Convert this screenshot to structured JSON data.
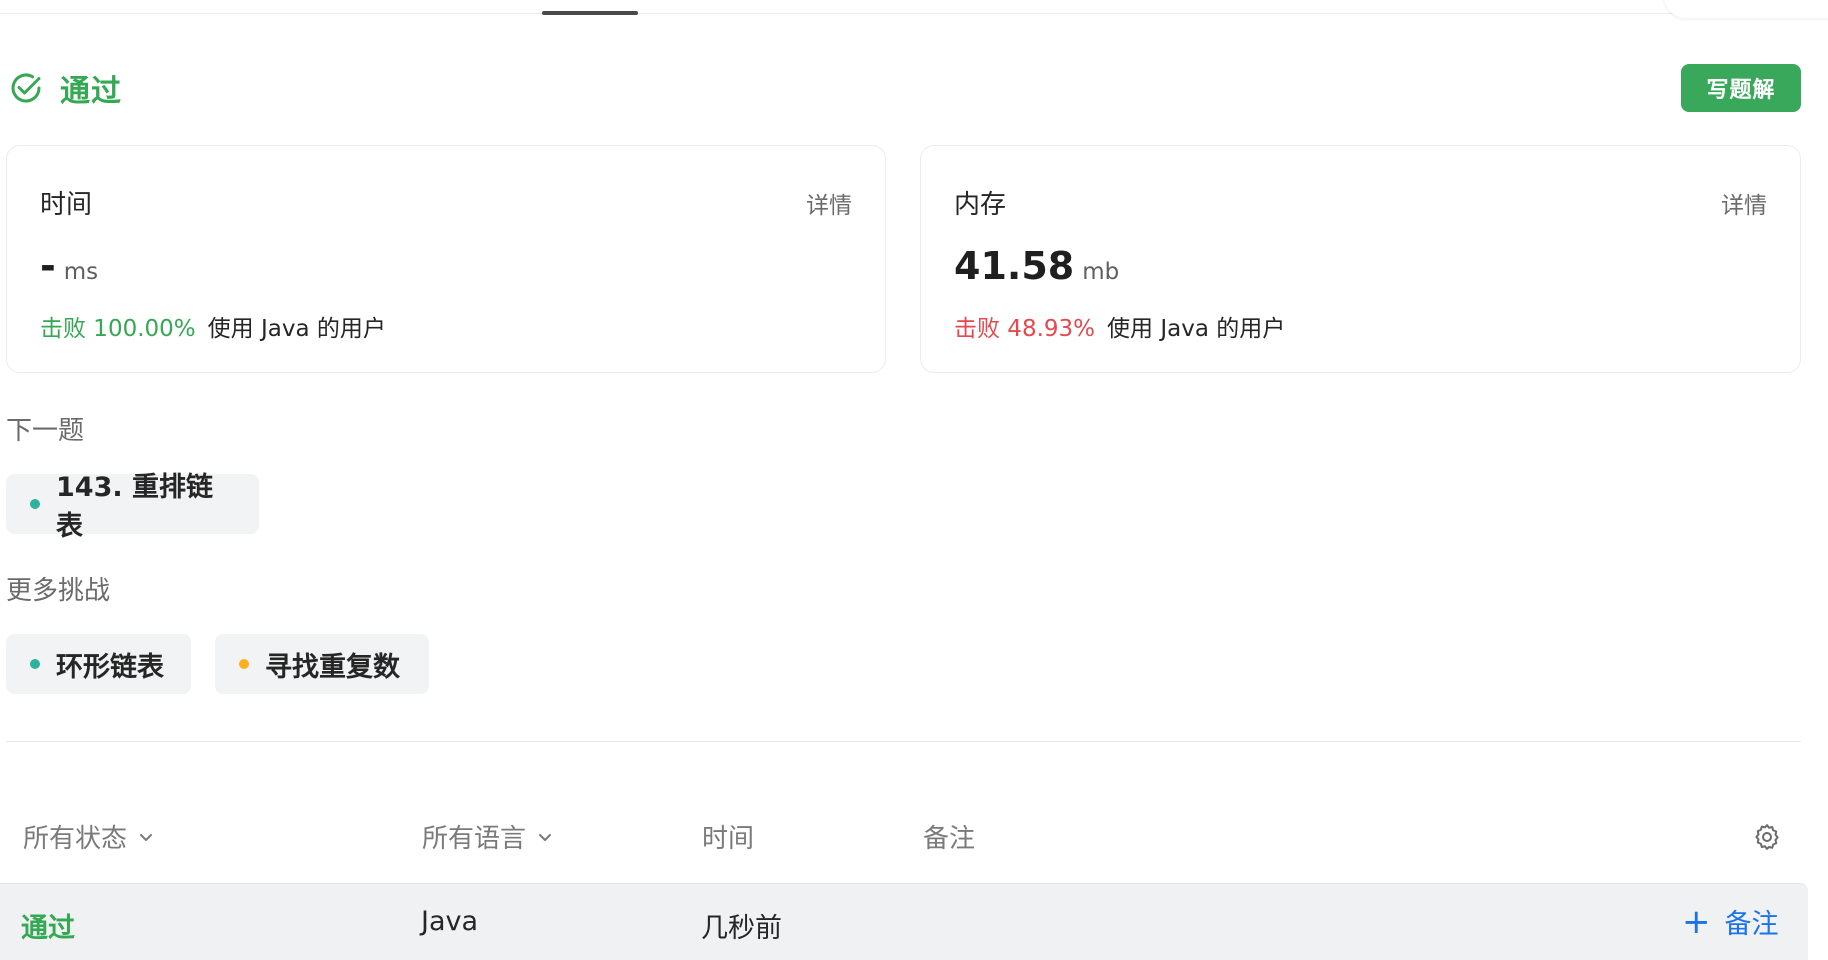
{
  "result": {
    "status_title": "通过",
    "write_solution_label": "写题解"
  },
  "runtime": {
    "label": "时间",
    "detail_label": "详情",
    "value": "-",
    "unit": "ms",
    "beat_prefix": "击败 100.00%",
    "beat_suffix": "使用 Java 的用户"
  },
  "memory": {
    "label": "内存",
    "detail_label": "详情",
    "value": "41.58",
    "unit": "mb",
    "beat_prefix": "击败 48.93%",
    "beat_suffix": "使用 Java 的用户"
  },
  "next_problem": {
    "section_label": "下一题",
    "title": "143. 重排链表",
    "dot_color": "#2db39a"
  },
  "more_challenges": {
    "section_label": "更多挑战",
    "items": [
      {
        "title": "环形链表",
        "dot_color": "#2db39a"
      },
      {
        "title": "寻找重复数",
        "dot_color": "#ffb020"
      }
    ]
  },
  "submissions": {
    "headers": {
      "status": "所有状态",
      "language": "所有语言",
      "time": "时间",
      "note": "备注"
    },
    "rows": [
      {
        "status": "通过",
        "language": "Java",
        "time": "几秒前",
        "add_note_label": "备注"
      }
    ]
  },
  "colors": {
    "accent_green": "#34a853",
    "accent_red": "#e5484d",
    "link_blue": "#1a73e8"
  }
}
